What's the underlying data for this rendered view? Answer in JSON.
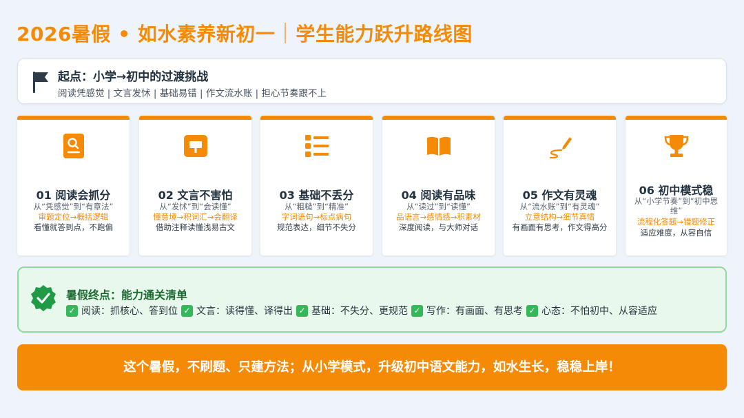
{
  "header": {
    "title_main": "2026暑假 • 如水素养新初一",
    "title_sub": "学生能力跃升路线图"
  },
  "start": {
    "icon": "flag-icon",
    "title": "起点：小学→初中的过渡挑战",
    "desc": "阅读凭感觉 | 文言发怵 | 基础易错 | 作文流水账 | 担心节奏跟不上"
  },
  "cards": [
    {
      "icon": "document-search-icon",
      "title": "01 阅读会抓分",
      "from": "从“凭感觉”到“有章法”",
      "path": "审题定位→概括逻辑",
      "note": "看懂就答到点，不跑偏"
    },
    {
      "icon": "scroll-icon",
      "title": "02 文言不害怕",
      "from": "从“发怵”到“会读懂”",
      "path": "懂意境→积词汇→会翻译",
      "note": "借助注释读懂浅易古文"
    },
    {
      "icon": "list-icon",
      "title": "03 基础不丢分",
      "from": "从“粗糙”到“精准”",
      "path": "字词语句→标点病句",
      "note": "规范表达，细节不失分"
    },
    {
      "icon": "open-book-icon",
      "title": "04 阅读有品味",
      "from": "从“读过”到“读懂”",
      "path": "品语言→感情感→积素材",
      "note": "深度阅读，与大师对话"
    },
    {
      "icon": "pen-icon",
      "title": "05 作文有灵魂",
      "from": "从“流水账”到“有灵魂”",
      "path": "立意结构→细节真情",
      "note": "有画面有思考，作文得高分"
    },
    {
      "icon": "trophy-icon",
      "title": "06 初中模式稳",
      "from": "从“小学节奏”到“初中思维”",
      "path": "流程化答题→错题修正",
      "note": "适应难度，从容自信"
    }
  ],
  "finish": {
    "icon": "check-badge-icon",
    "title": "暑假终点：能力通关清单",
    "items": [
      "阅读：抓核心、答到位",
      "文言：读得懂、译得出",
      "基础：不失分、更规范",
      "写作：有画面、有思考",
      "心态：不怕初中、从容适应"
    ]
  },
  "banner": {
    "text": "这个暑假，不刷题、只建方法；从小学模式，升级初中语文能力，如水生长，稳稳上岸！"
  },
  "colors": {
    "accent": "#f58a07",
    "success": "#34b85a",
    "background": "#eef4fa"
  }
}
